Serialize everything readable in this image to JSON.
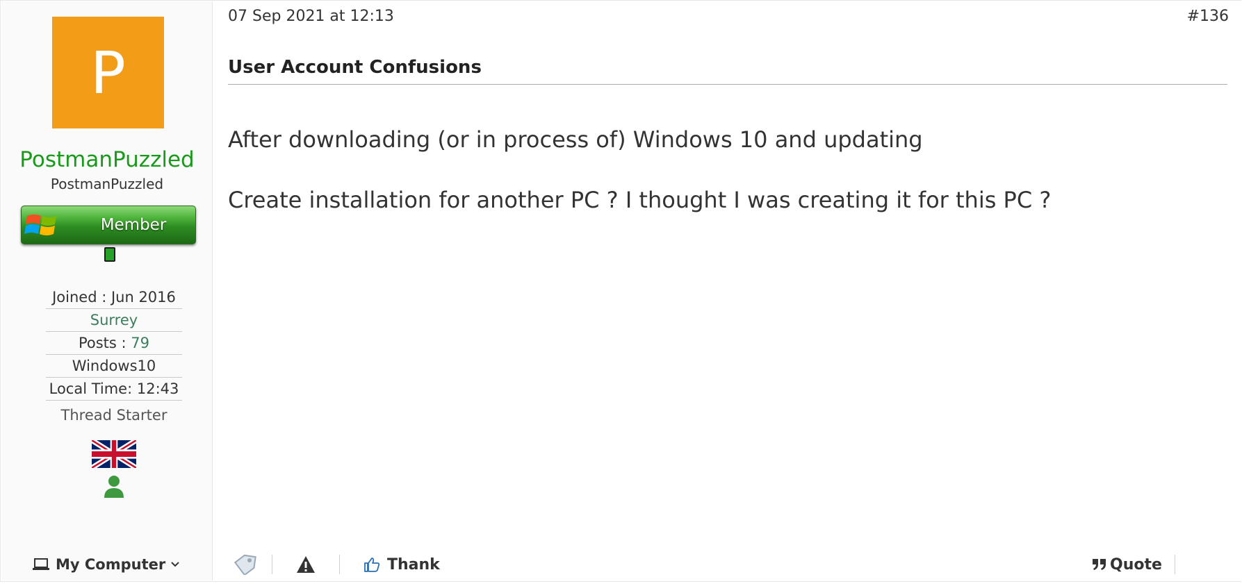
{
  "user": {
    "avatar_letter": "P",
    "avatar_color": "#f39c18",
    "username": "PostmanPuzzled",
    "subname": "PostmanPuzzled",
    "rank": "Member",
    "joined": "Joined : Jun 2016",
    "location": "Surrey",
    "posts_label": "Posts : ",
    "posts_count": "79",
    "os": "Windows10",
    "local_time": "Local Time: 12:43",
    "role": "Thread Starter",
    "my_computer": "My Computer"
  },
  "post": {
    "date": "07 Sep 2021 at 12:13",
    "number": "#136",
    "title": "User Account Confusions",
    "paragraphs": [
      "After downloading (or in process of) Windows 10 and updating",
      "Create installation for another PC ? I thought I was creating it for this PC ?"
    ]
  },
  "actions": {
    "thank": "Thank",
    "quote": "Quote"
  },
  "colors": {
    "username": "#1a9a1a",
    "accent_green": "#3b7d5c",
    "online": "#27a127"
  },
  "icons": [
    "laptop-icon",
    "chevron-down-icon",
    "tag-icon",
    "warning-icon",
    "thumbs-up-icon",
    "quote-icon",
    "uk-flag-icon",
    "person-icon"
  ]
}
